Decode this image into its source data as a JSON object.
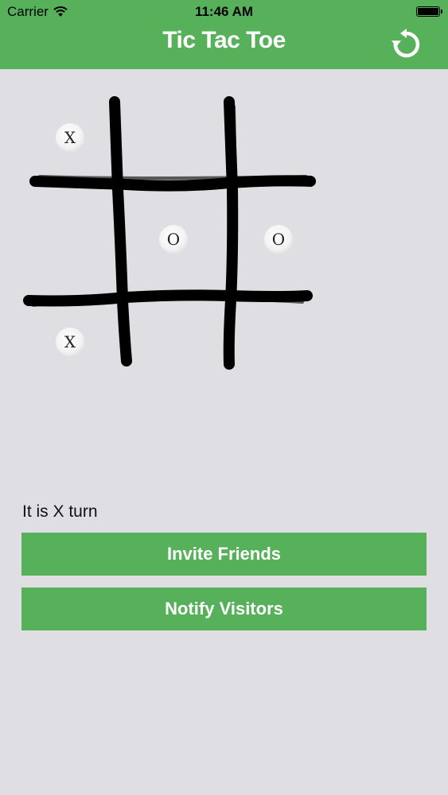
{
  "status_bar": {
    "carrier": "Carrier",
    "time": "11:46 AM"
  },
  "nav": {
    "title": "Tic Tac Toe",
    "refresh_icon": "refresh-icon"
  },
  "board": {
    "cells": [
      [
        "X",
        "",
        ""
      ],
      [
        "",
        "O",
        "O"
      ],
      [
        "X",
        "",
        ""
      ]
    ]
  },
  "turn_text": "It is X turn",
  "buttons": {
    "invite": "Invite Friends",
    "notify": "Notify Visitors"
  },
  "colors": {
    "accent": "#56b15a",
    "background": "#dfdfe3"
  }
}
